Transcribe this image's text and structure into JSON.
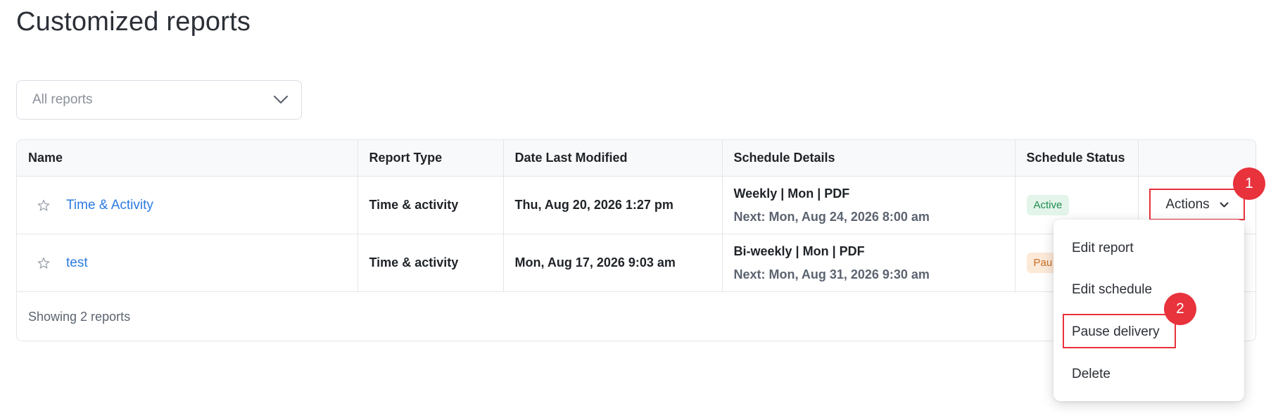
{
  "page": {
    "title": "Customized reports"
  },
  "filter": {
    "selected": "All reports",
    "icon": "chevron-down-icon"
  },
  "table": {
    "columns": [
      "Name",
      "Report Type",
      "Date Last Modified",
      "Schedule Details",
      "Schedule Status",
      ""
    ],
    "rows": [
      {
        "name": "Time & Activity",
        "type": "Time & activity",
        "modified": "Thu, Aug 20, 2026 1:27 pm",
        "schedule": "Weekly | Mon | PDF",
        "next": "Next: Mon, Aug 24, 2026 8:00 am",
        "status": "Active"
      },
      {
        "name": "test",
        "type": "Time & activity",
        "modified": "Mon, Aug 17, 2026 9:03 am",
        "schedule": "Bi-weekly | Mon | PDF",
        "next": "Next: Mon, Aug 31, 2026 9:30 am",
        "status": "Pau"
      }
    ],
    "footer": "Showing 2 reports"
  },
  "actions": {
    "label": "Actions",
    "menu": [
      "Edit report",
      "Edit schedule",
      "Pause delivery",
      "Delete"
    ]
  },
  "annotations": {
    "marker1": "1",
    "marker2": "2"
  },
  "colors": {
    "accent": "#2a7ae2",
    "highlight": "#e8323c",
    "active_bg": "#e3f5ea",
    "active_text": "#1f8a4d",
    "paused_bg": "#fde9d8",
    "paused_text": "#c96f28"
  }
}
